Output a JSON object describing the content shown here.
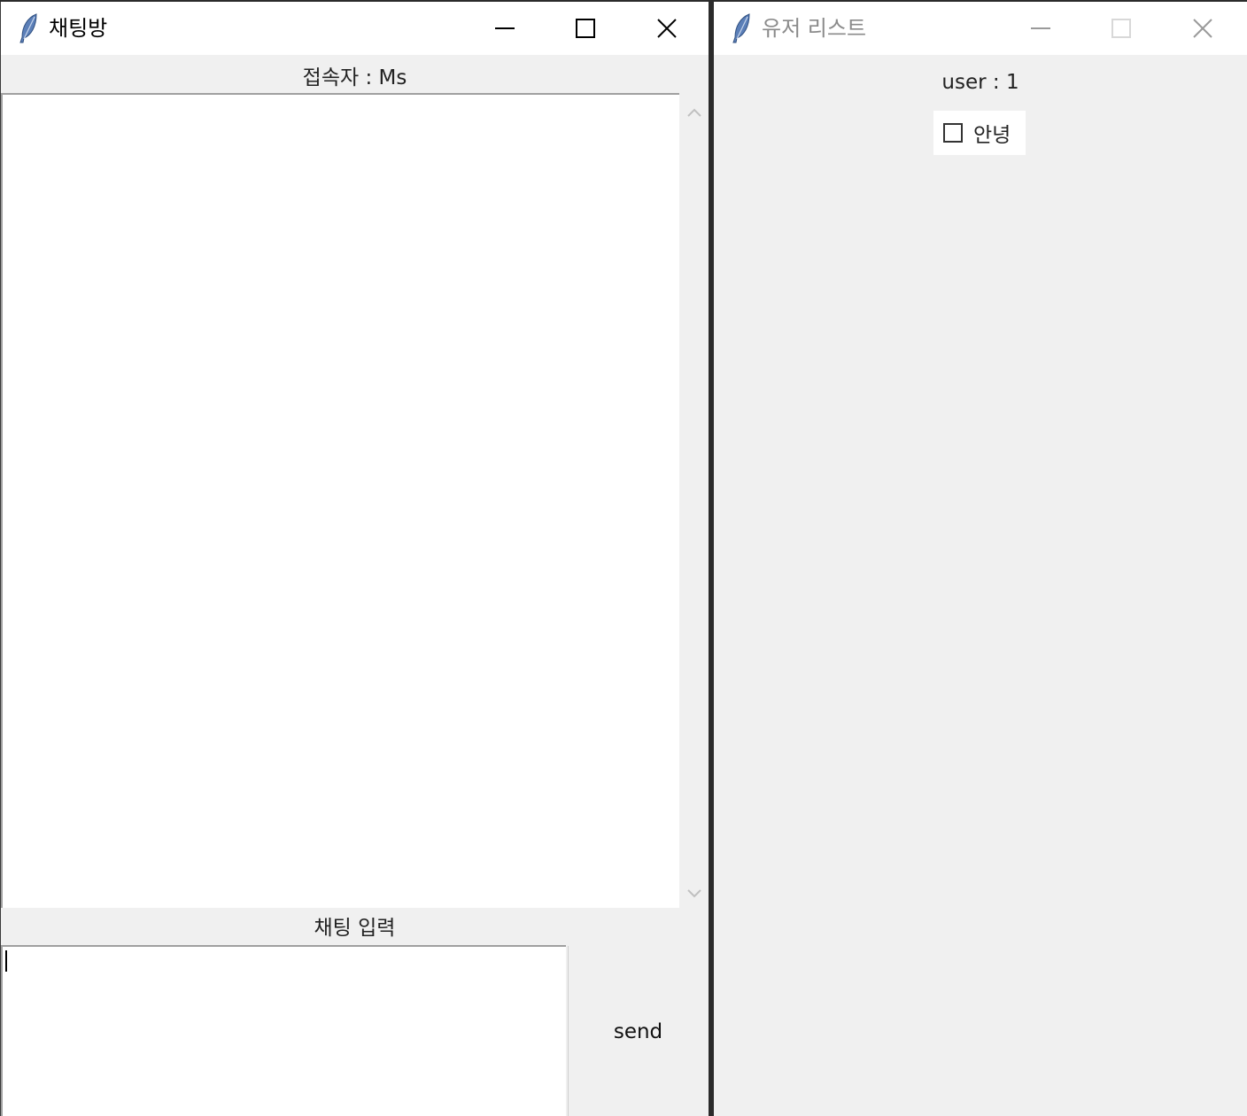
{
  "chat_window": {
    "title": "채팅방",
    "connected_label": "접속자 : Ms",
    "input_label": "채팅 입력",
    "send_label": "send",
    "input_value": ""
  },
  "user_window": {
    "title": "유저 리스트",
    "user_count": "user : 1",
    "users": [
      {
        "name": "안녕",
        "checked": false
      }
    ]
  },
  "icons": {
    "app": "tk-feather-icon",
    "minimize": "minimize-icon",
    "maximize": "maximize-icon",
    "close": "close-icon",
    "scroll_up": "chevron-up-icon",
    "scroll_down": "chevron-down-icon"
  },
  "colors": {
    "window_bg": "#f0f0f0",
    "titlebar_bg": "#ffffff",
    "inactive_title": "#8a8a8a",
    "feather_blue": "#5b7fb8"
  }
}
